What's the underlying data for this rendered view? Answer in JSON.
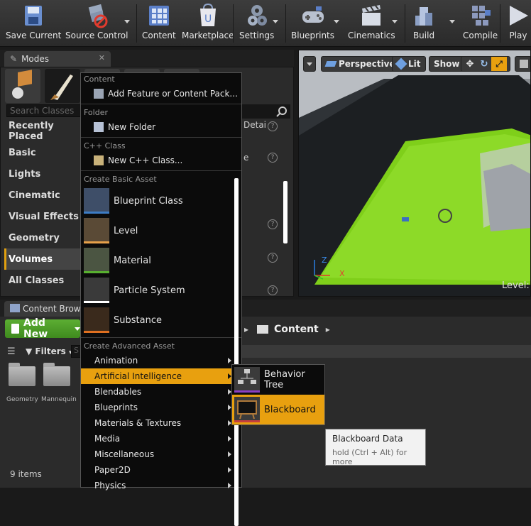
{
  "toolbar": {
    "items": [
      {
        "label": "Save Current",
        "icon": "save-icon"
      },
      {
        "label": "Source Control",
        "icon": "source-control-icon"
      },
      {
        "label": "Content",
        "icon": "content-icon"
      },
      {
        "label": "Marketplace",
        "icon": "marketplace-icon"
      },
      {
        "label": "Settings",
        "icon": "settings-icon"
      },
      {
        "label": "Blueprints",
        "icon": "blueprints-icon"
      },
      {
        "label": "Cinematics",
        "icon": "cinematics-icon"
      },
      {
        "label": "Build",
        "icon": "build-icon"
      },
      {
        "label": "Compile",
        "icon": "compile-icon"
      },
      {
        "label": "Play",
        "icon": "play-icon"
      }
    ]
  },
  "modes": {
    "tab_label": "Modes",
    "search_placeholder": "Search Classes",
    "categories": [
      "Recently Placed",
      "Basic",
      "Lights",
      "Cinematic",
      "Visual Effects",
      "Geometry",
      "Volumes",
      "All Classes"
    ],
    "active_category": "Volumes",
    "partial_right_text_1": "Detai",
    "partial_right_text_2": "e"
  },
  "viewport": {
    "perspective_label": "Perspective",
    "lit_label": "Lit",
    "show_label": "Show",
    "level_label": "Level:",
    "axis_z": "Z",
    "axis_x": "X"
  },
  "content_browser": {
    "tab_label": "Content Brows",
    "add_new_label": "Add New",
    "path_label": "Content",
    "filters_label": "Filters",
    "search_placeholder": "S",
    "folders": [
      "Geometry",
      "Mannequin"
    ],
    "items_count": "9 items"
  },
  "menu": {
    "section_content": "Content",
    "add_feature": "Add Feature or Content Pack...",
    "section_folder": "Folder",
    "new_folder": "New Folder",
    "section_cpp": "C++ Class",
    "new_cpp": "New C++ Class...",
    "section_basic": "Create Basic Asset",
    "basic_assets": [
      {
        "label": "Blueprint Class",
        "icon": "blueprint-class-icon",
        "accent": "#3d7cc4"
      },
      {
        "label": "Level",
        "icon": "level-icon",
        "accent": "#e5a04a"
      },
      {
        "label": "Material",
        "icon": "material-icon",
        "accent": "#58b030"
      },
      {
        "label": "Particle System",
        "icon": "particle-system-icon",
        "accent": "#ffffff"
      },
      {
        "label": "Substance",
        "icon": "substance-icon",
        "accent": "#e07020"
      }
    ],
    "section_advanced": "Create Advanced Asset",
    "advanced_assets": [
      "Animation",
      "Artificial Intelligence",
      "Blendables",
      "Blueprints",
      "Materials & Textures",
      "Media",
      "Miscellaneous",
      "Paper2D",
      "Physics"
    ],
    "highlighted": "Artificial Intelligence"
  },
  "submenu": {
    "items": [
      {
        "label": "Behavior Tree",
        "icon": "behavior-tree-icon"
      },
      {
        "label": "Blackboard",
        "icon": "blackboard-icon"
      }
    ],
    "highlighted": "Blackboard"
  },
  "tooltip": {
    "title": "Blackboard Data",
    "hint": "hold (Ctrl + Alt) for more"
  },
  "colors": {
    "highlight": "#e8a00f",
    "add_new_green": "#4f9e2a",
    "viewport_floor": "#7fcf1a"
  }
}
